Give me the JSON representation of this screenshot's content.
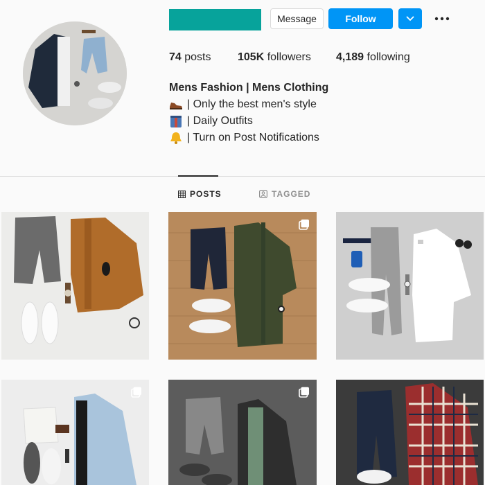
{
  "profile": {
    "username_redacted_color": "#07a39b",
    "buttons": {
      "message": "Message",
      "follow": "Follow"
    },
    "stats": [
      {
        "num": "74",
        "label": "posts"
      },
      {
        "num": "105K",
        "label": "followers"
      },
      {
        "num": "4,189",
        "label": "following"
      }
    ],
    "bio": {
      "name": "Mens Fashion | Mens Clothing",
      "lines": [
        {
          "icon": "shoe-icon",
          "text": "| Only the best men's style"
        },
        {
          "icon": "clothes-icon",
          "text": "| Daily Outfits"
        },
        {
          "icon": "bell-icon",
          "text": "| Turn on Post Notifications"
        }
      ]
    }
  },
  "tabs": [
    {
      "label": "POSTS",
      "icon": "grid-icon",
      "active": true
    },
    {
      "label": "TAGGED",
      "icon": "tag-icon",
      "active": false
    }
  ],
  "colors": {
    "accent": "#0095f6",
    "text": "#262626",
    "muted": "#8e8e8e"
  },
  "grid": [
    {
      "name": "post-1",
      "multi": false
    },
    {
      "name": "post-2",
      "multi": true
    },
    {
      "name": "post-3",
      "multi": false
    },
    {
      "name": "post-4",
      "multi": true
    },
    {
      "name": "post-5",
      "multi": true
    },
    {
      "name": "post-6",
      "multi": false
    }
  ]
}
